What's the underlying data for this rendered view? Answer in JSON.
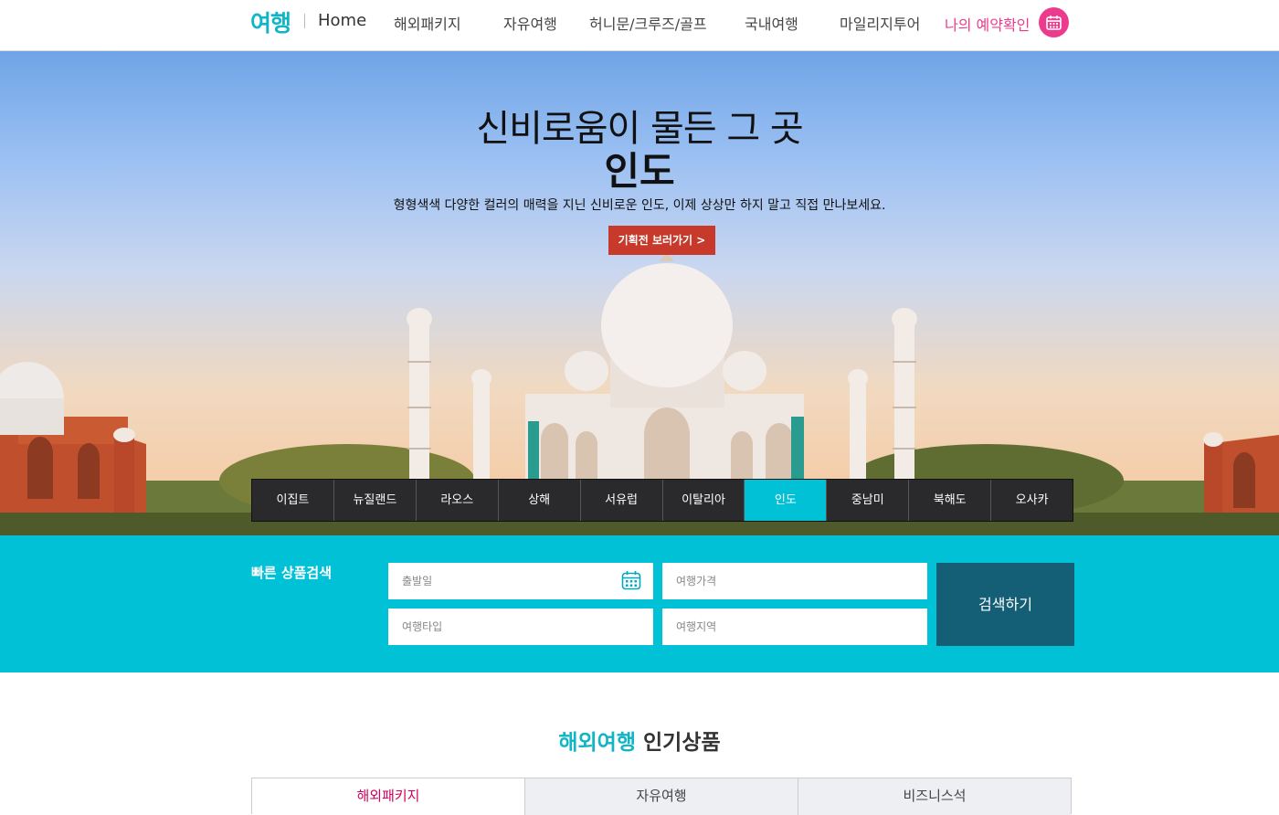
{
  "nav": {
    "logo": "여행",
    "home": "Home",
    "items": [
      "해외패키지",
      "자유여행",
      "허니문/크루즈/골프",
      "국내여행",
      "마일리지투어"
    ],
    "my_booking": "나의 예약확인",
    "accent_color": "#00c1d5",
    "pink_color": "#ec3b8e"
  },
  "hero": {
    "title": "신비로움이 물든 그 곳",
    "destination": "인도",
    "description": "형형색색 다양한 컬러의 매력을 지닌 신비로운 인도, 이제 상상만 하지 말고 직접 만나보세요.",
    "button": "기획전 보러가기  >",
    "tabs": [
      "이집트",
      "뉴질랜드",
      "라오스",
      "상해",
      "서유럽",
      "이탈리아",
      "인도",
      "중남미",
      "북해도",
      "오사카"
    ],
    "active_tab": "인도"
  },
  "search": {
    "label": "빠른 상품검색",
    "departure_placeholder": "출발일",
    "price_placeholder": "여행가격",
    "type_placeholder": "여행타입",
    "region_placeholder": "여행지역",
    "button": "검색하기"
  },
  "popular": {
    "title_accent": "해외여행",
    "title_rest": "인기상품",
    "tabs": [
      "해외패키지",
      "자유여행",
      "비즈니스석"
    ],
    "active_tab": "해외패키지"
  }
}
